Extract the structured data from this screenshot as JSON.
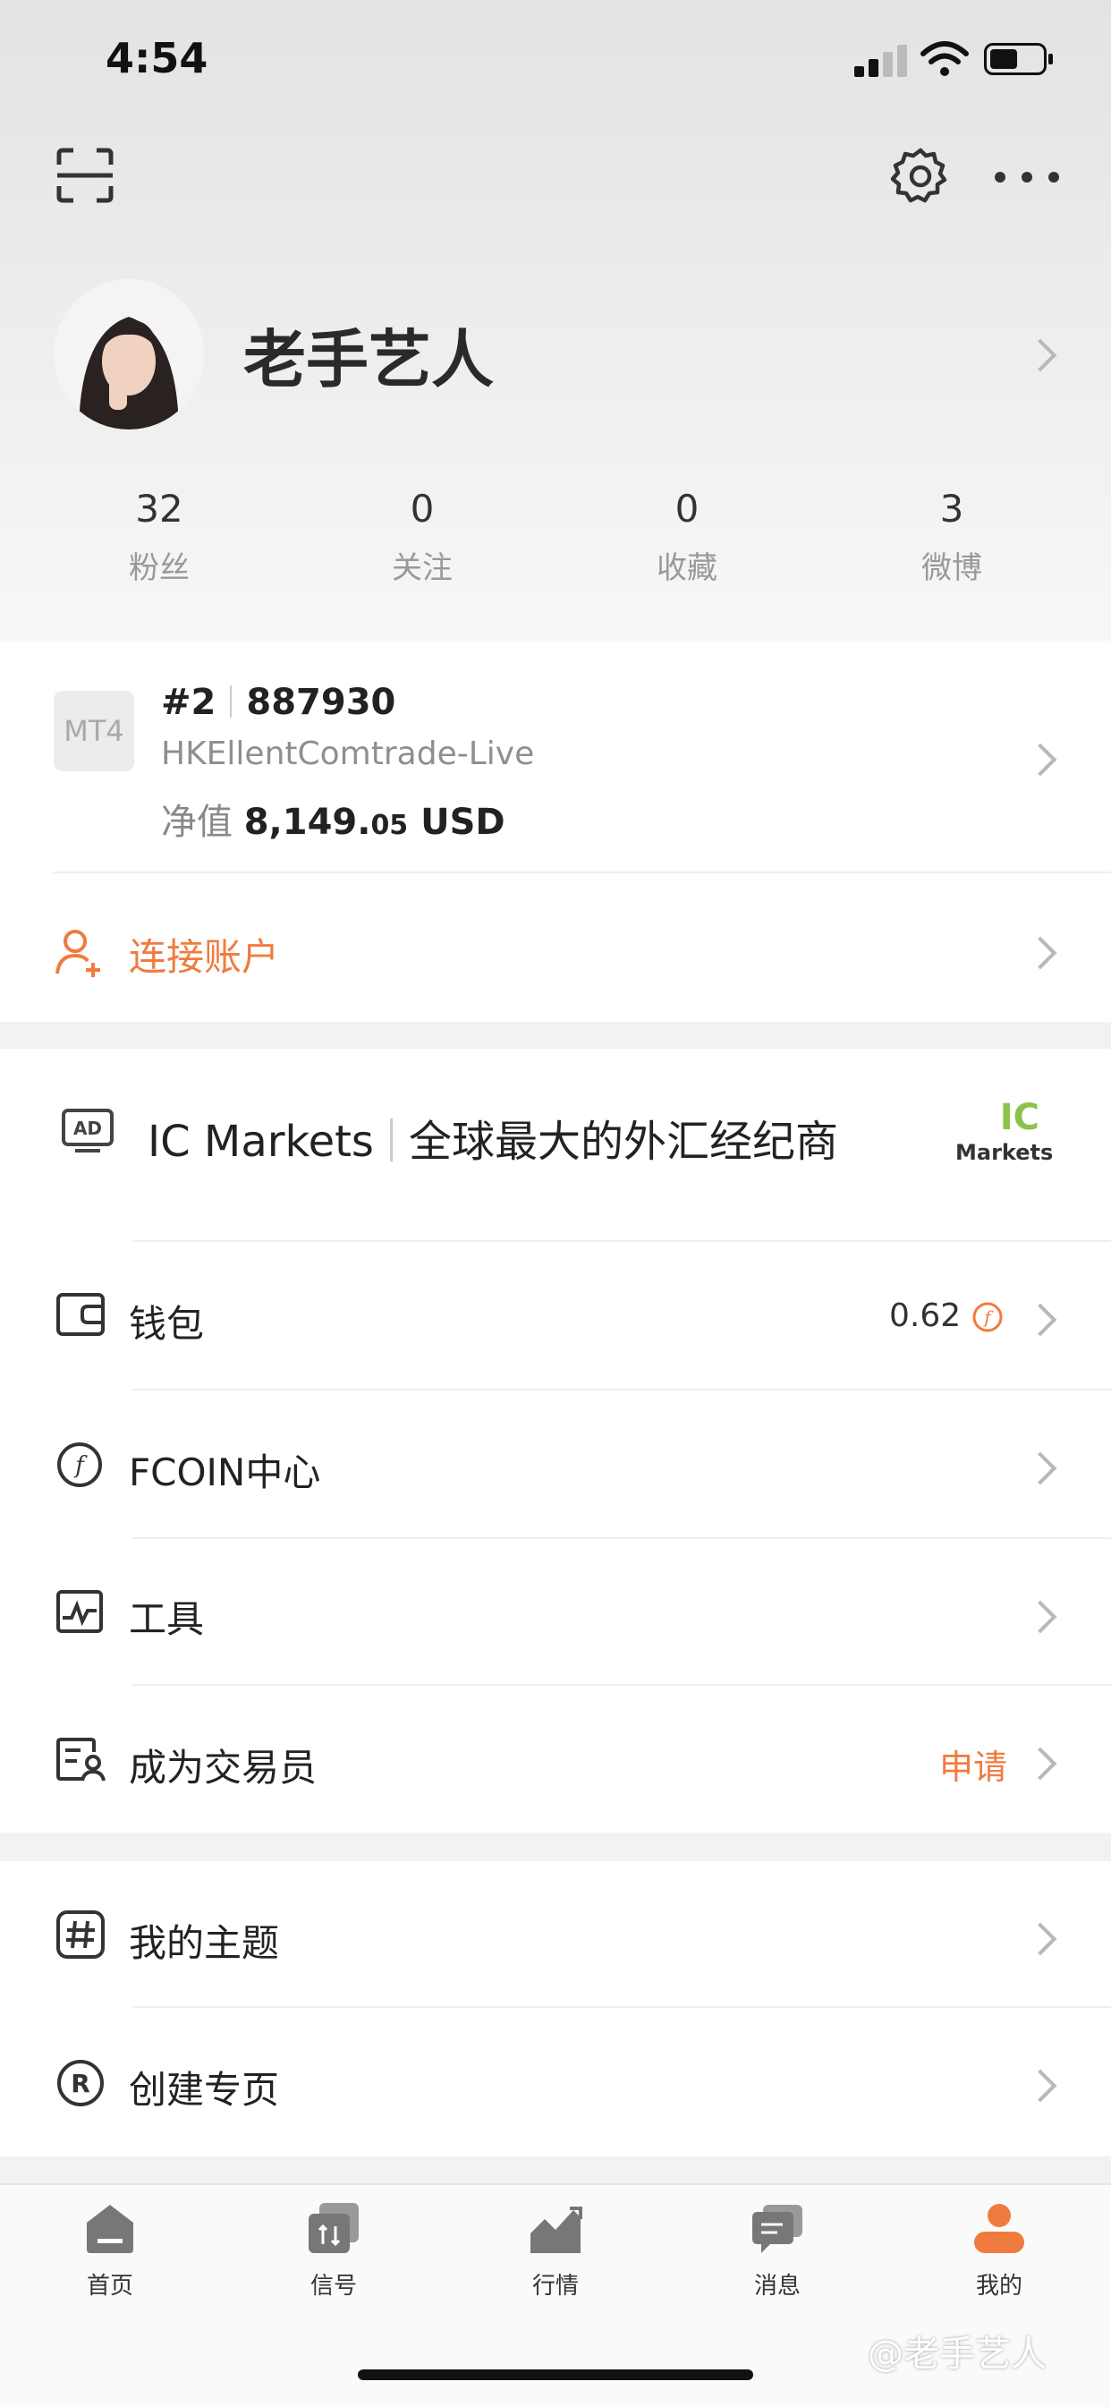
{
  "status_bar": {
    "time": "4:54"
  },
  "profile": {
    "username": "老手艺人"
  },
  "stats": [
    {
      "value": "32",
      "label": "粉丝"
    },
    {
      "value": "0",
      "label": "关注"
    },
    {
      "value": "0",
      "label": "收藏"
    },
    {
      "value": "3",
      "label": "微博"
    }
  ],
  "account": {
    "platform": "MT4",
    "index": "#2",
    "number": "887930",
    "server": "HKEllentComtrade-Live",
    "equity_label": "净值",
    "equity_main": "8,149.",
    "equity_cents": "05",
    "currency": "USD"
  },
  "connect": {
    "label": "连接账户"
  },
  "ad": {
    "brand": "IC Markets",
    "tagline": "全球最大的外汇经纪商",
    "logo_top": "IC",
    "logo_bottom": "Markets"
  },
  "menu": {
    "wallet": {
      "label": "钱包",
      "value": "0.62"
    },
    "fcoin": {
      "label": "FCOIN中心"
    },
    "tools": {
      "label": "工具"
    },
    "trader": {
      "label": "成为交易员",
      "action": "申请"
    },
    "topics": {
      "label": "我的主题"
    },
    "page": {
      "label": "创建专页"
    }
  },
  "tabs": [
    {
      "label": "首页"
    },
    {
      "label": "信号"
    },
    {
      "label": "行情"
    },
    {
      "label": "消息"
    },
    {
      "label": "我的"
    }
  ],
  "watermark": "@老手艺人",
  "colors": {
    "accent": "#f07b3f",
    "background": "#f2f2f2"
  }
}
